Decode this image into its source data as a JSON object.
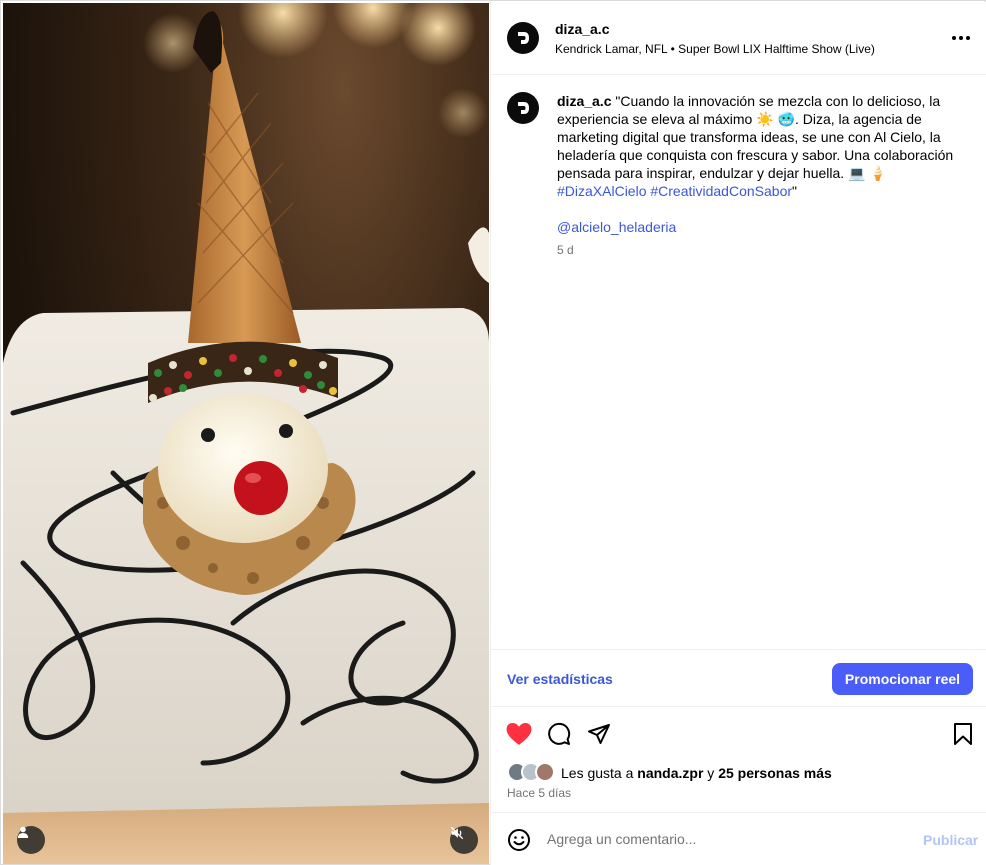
{
  "post": {
    "username": "diza_a.c",
    "audio": "Kendrick Lamar, NFL • Super Bowl LIX Halftime Show (Live)",
    "caption": {
      "username": "diza_a.c",
      "text_part1": " \"Cuando la innovación se mezcla con lo delicioso, la experiencia se eleva al máximo ☀️ 🥶. Diza, la agencia de marketing digital que transforma ideas, se une con Al Cielo, la heladería que conquista con frescura y sabor. Una colaboración pensada para inspirar, endulzar y dejar huella. 💻 🍦",
      "hashtags": "#DizaXAlCielo #CreatividadConSabor",
      "text_end": "\""
    },
    "mention": "@alcielo_heladeria",
    "caption_age": "5 d"
  },
  "stats": {
    "link_label": "Ver estadísticas",
    "promote_label": "Promocionar reel"
  },
  "likes": {
    "prefix": "Les gusta a ",
    "user": "nanda.zpr",
    "middle": " y ",
    "others": "25 personas más"
  },
  "timestamp": "Hace 5 días",
  "comment": {
    "placeholder": "Agrega un comentario...",
    "publish_label": "Publicar"
  },
  "colors": {
    "link_blue": "#3b57d9",
    "promote_button": "#4a5df9",
    "like_red": "#ff3040",
    "publish_disabled": "#b3c5f7"
  },
  "icons": {
    "like": "heart-icon",
    "comment": "comment-bubble-icon",
    "share": "paper-plane-icon",
    "save": "bookmark-icon",
    "emoji": "emoji-smile-icon",
    "more": "more-options-icon",
    "tagged_users": "user-tag-icon",
    "mute": "speaker-muted-icon"
  }
}
